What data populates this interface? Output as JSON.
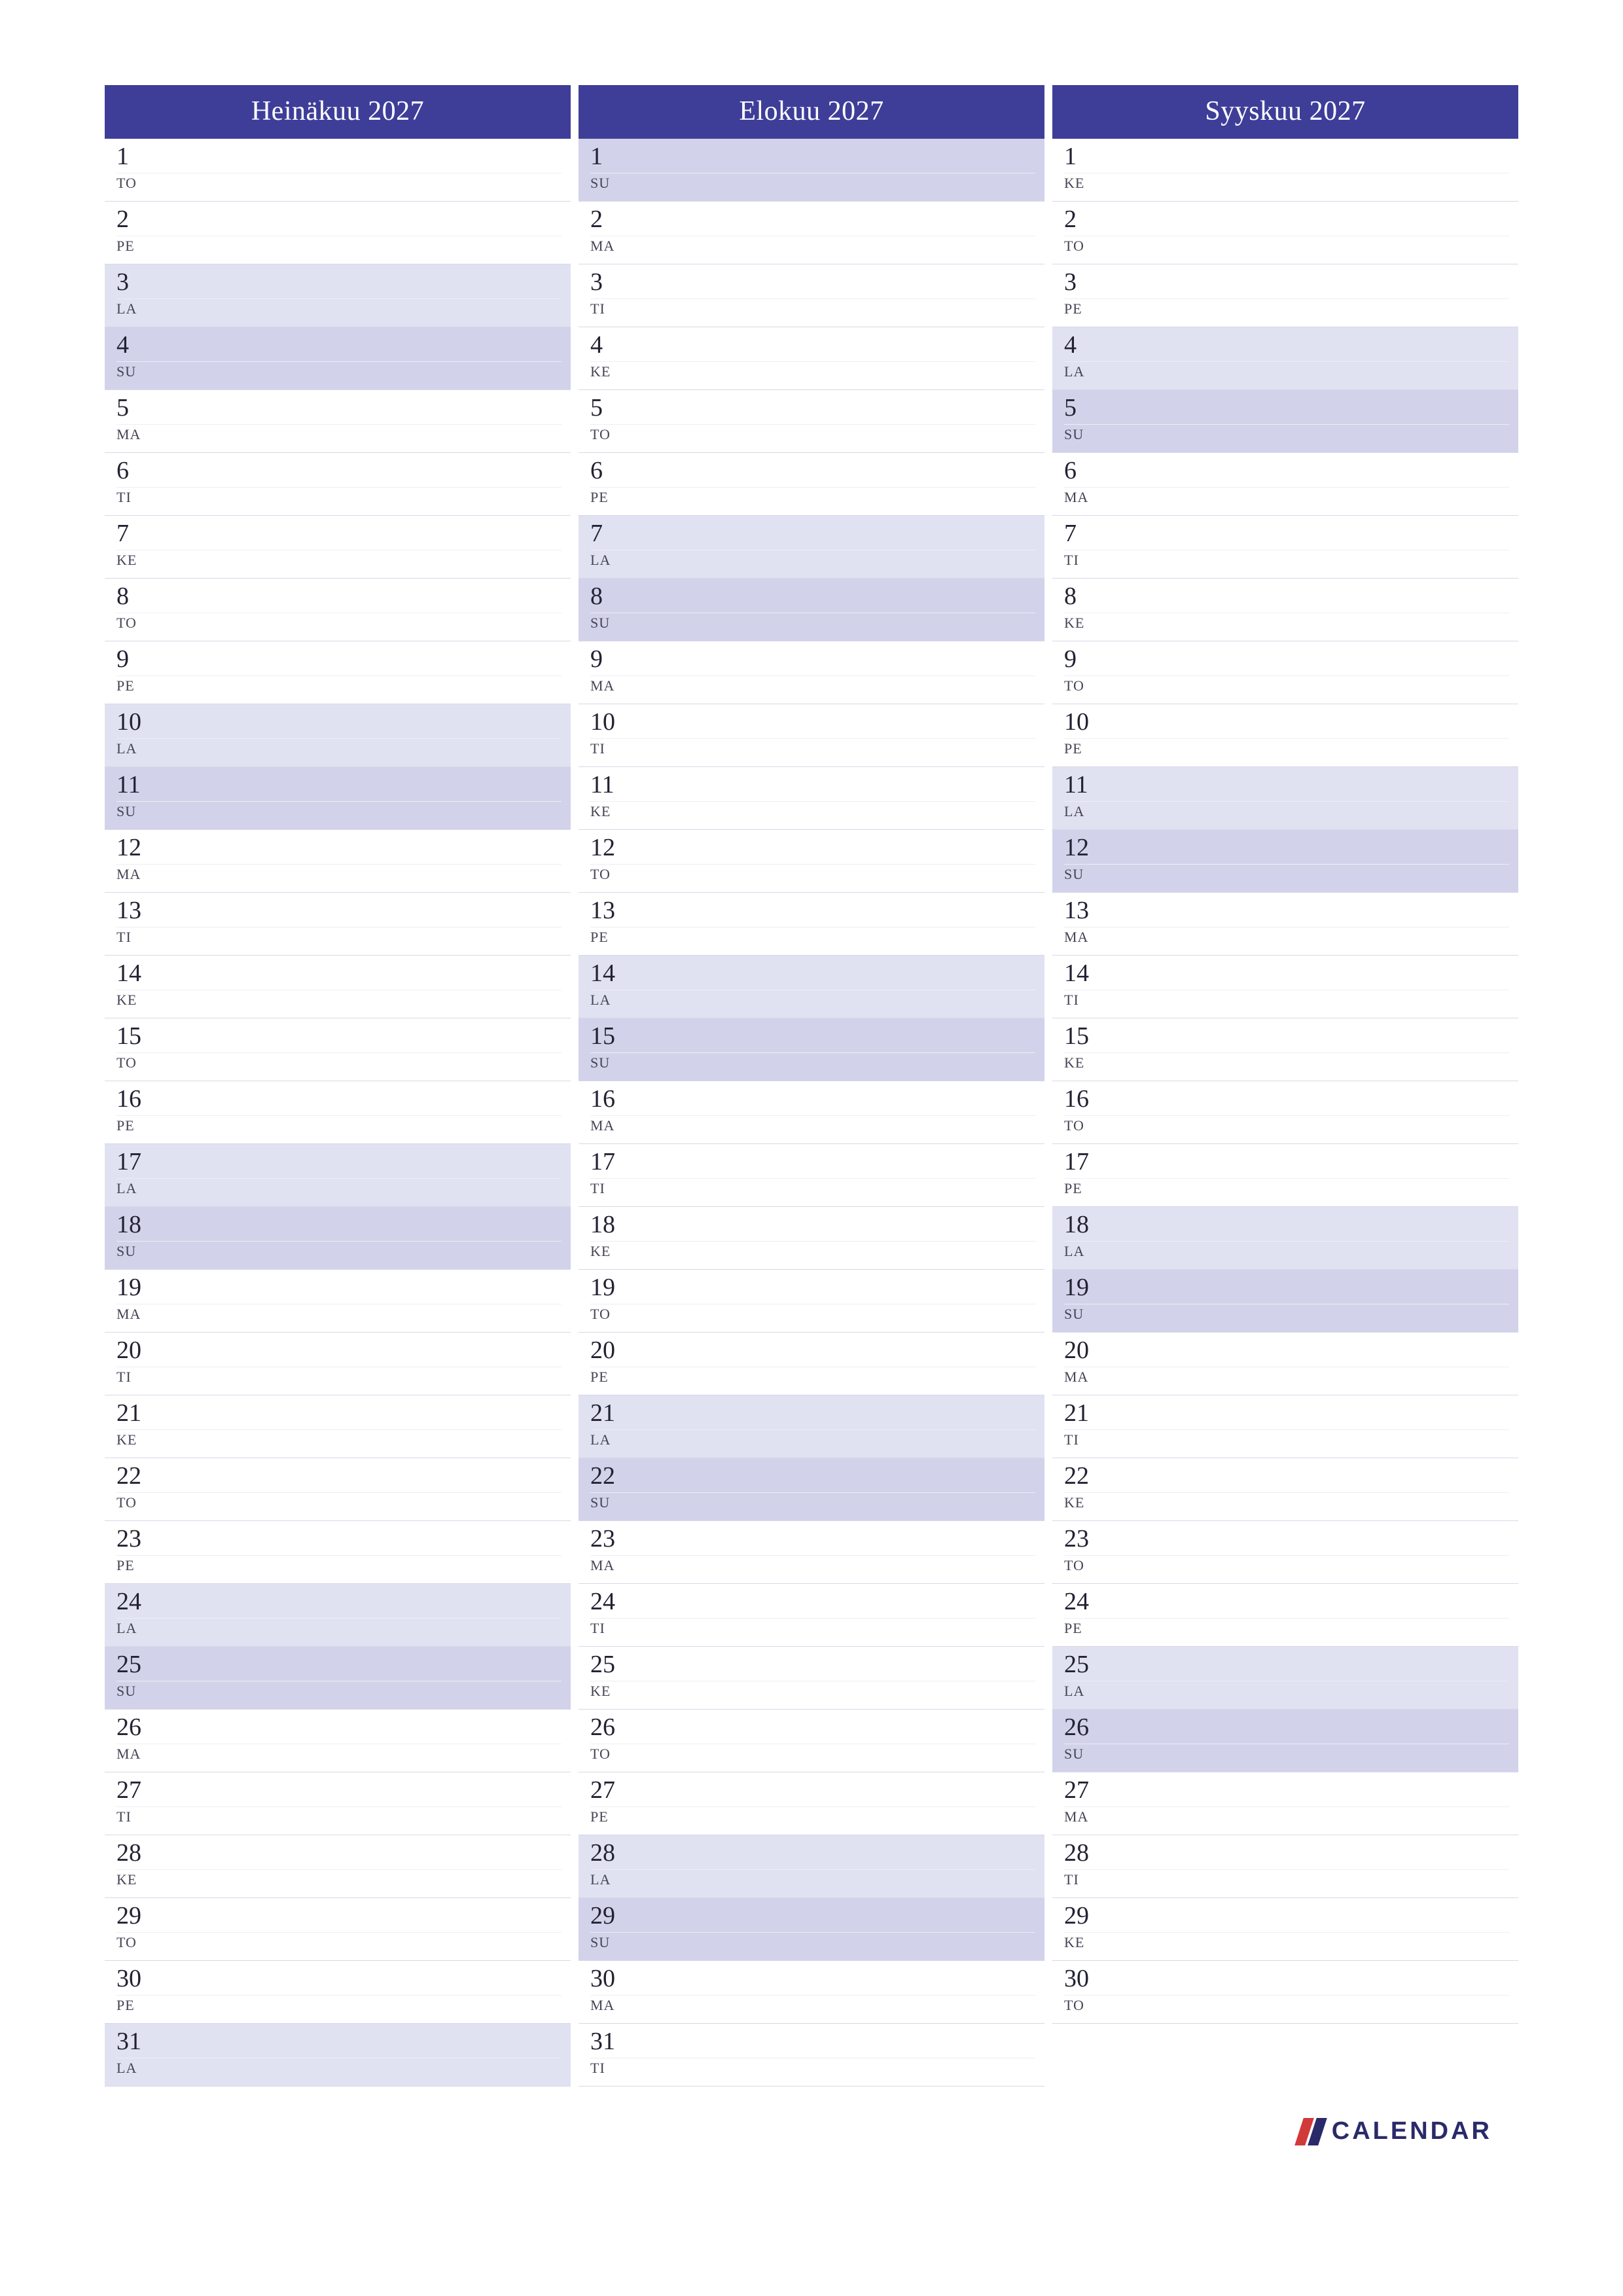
{
  "months": [
    {
      "title": "Heinäkuu 2027",
      "days": [
        {
          "n": "1",
          "a": "TO",
          "t": "weekday"
        },
        {
          "n": "2",
          "a": "PE",
          "t": "weekday"
        },
        {
          "n": "3",
          "a": "LA",
          "t": "sat"
        },
        {
          "n": "4",
          "a": "SU",
          "t": "sun"
        },
        {
          "n": "5",
          "a": "MA",
          "t": "weekday"
        },
        {
          "n": "6",
          "a": "TI",
          "t": "weekday"
        },
        {
          "n": "7",
          "a": "KE",
          "t": "weekday"
        },
        {
          "n": "8",
          "a": "TO",
          "t": "weekday"
        },
        {
          "n": "9",
          "a": "PE",
          "t": "weekday"
        },
        {
          "n": "10",
          "a": "LA",
          "t": "sat"
        },
        {
          "n": "11",
          "a": "SU",
          "t": "sun"
        },
        {
          "n": "12",
          "a": "MA",
          "t": "weekday"
        },
        {
          "n": "13",
          "a": "TI",
          "t": "weekday"
        },
        {
          "n": "14",
          "a": "KE",
          "t": "weekday"
        },
        {
          "n": "15",
          "a": "TO",
          "t": "weekday"
        },
        {
          "n": "16",
          "a": "PE",
          "t": "weekday"
        },
        {
          "n": "17",
          "a": "LA",
          "t": "sat"
        },
        {
          "n": "18",
          "a": "SU",
          "t": "sun"
        },
        {
          "n": "19",
          "a": "MA",
          "t": "weekday"
        },
        {
          "n": "20",
          "a": "TI",
          "t": "weekday"
        },
        {
          "n": "21",
          "a": "KE",
          "t": "weekday"
        },
        {
          "n": "22",
          "a": "TO",
          "t": "weekday"
        },
        {
          "n": "23",
          "a": "PE",
          "t": "weekday"
        },
        {
          "n": "24",
          "a": "LA",
          "t": "sat"
        },
        {
          "n": "25",
          "a": "SU",
          "t": "sun"
        },
        {
          "n": "26",
          "a": "MA",
          "t": "weekday"
        },
        {
          "n": "27",
          "a": "TI",
          "t": "weekday"
        },
        {
          "n": "28",
          "a": "KE",
          "t": "weekday"
        },
        {
          "n": "29",
          "a": "TO",
          "t": "weekday"
        },
        {
          "n": "30",
          "a": "PE",
          "t": "weekday"
        },
        {
          "n": "31",
          "a": "LA",
          "t": "sat"
        }
      ]
    },
    {
      "title": "Elokuu 2027",
      "days": [
        {
          "n": "1",
          "a": "SU",
          "t": "sun"
        },
        {
          "n": "2",
          "a": "MA",
          "t": "weekday"
        },
        {
          "n": "3",
          "a": "TI",
          "t": "weekday"
        },
        {
          "n": "4",
          "a": "KE",
          "t": "weekday"
        },
        {
          "n": "5",
          "a": "TO",
          "t": "weekday"
        },
        {
          "n": "6",
          "a": "PE",
          "t": "weekday"
        },
        {
          "n": "7",
          "a": "LA",
          "t": "sat"
        },
        {
          "n": "8",
          "a": "SU",
          "t": "sun"
        },
        {
          "n": "9",
          "a": "MA",
          "t": "weekday"
        },
        {
          "n": "10",
          "a": "TI",
          "t": "weekday"
        },
        {
          "n": "11",
          "a": "KE",
          "t": "weekday"
        },
        {
          "n": "12",
          "a": "TO",
          "t": "weekday"
        },
        {
          "n": "13",
          "a": "PE",
          "t": "weekday"
        },
        {
          "n": "14",
          "a": "LA",
          "t": "sat"
        },
        {
          "n": "15",
          "a": "SU",
          "t": "sun"
        },
        {
          "n": "16",
          "a": "MA",
          "t": "weekday"
        },
        {
          "n": "17",
          "a": "TI",
          "t": "weekday"
        },
        {
          "n": "18",
          "a": "KE",
          "t": "weekday"
        },
        {
          "n": "19",
          "a": "TO",
          "t": "weekday"
        },
        {
          "n": "20",
          "a": "PE",
          "t": "weekday"
        },
        {
          "n": "21",
          "a": "LA",
          "t": "sat"
        },
        {
          "n": "22",
          "a": "SU",
          "t": "sun"
        },
        {
          "n": "23",
          "a": "MA",
          "t": "weekday"
        },
        {
          "n": "24",
          "a": "TI",
          "t": "weekday"
        },
        {
          "n": "25",
          "a": "KE",
          "t": "weekday"
        },
        {
          "n": "26",
          "a": "TO",
          "t": "weekday"
        },
        {
          "n": "27",
          "a": "PE",
          "t": "weekday"
        },
        {
          "n": "28",
          "a": "LA",
          "t": "sat"
        },
        {
          "n": "29",
          "a": "SU",
          "t": "sun"
        },
        {
          "n": "30",
          "a": "MA",
          "t": "weekday"
        },
        {
          "n": "31",
          "a": "TI",
          "t": "weekday"
        }
      ]
    },
    {
      "title": "Syyskuu 2027",
      "days": [
        {
          "n": "1",
          "a": "KE",
          "t": "weekday"
        },
        {
          "n": "2",
          "a": "TO",
          "t": "weekday"
        },
        {
          "n": "3",
          "a": "PE",
          "t": "weekday"
        },
        {
          "n": "4",
          "a": "LA",
          "t": "sat"
        },
        {
          "n": "5",
          "a": "SU",
          "t": "sun"
        },
        {
          "n": "6",
          "a": "MA",
          "t": "weekday"
        },
        {
          "n": "7",
          "a": "TI",
          "t": "weekday"
        },
        {
          "n": "8",
          "a": "KE",
          "t": "weekday"
        },
        {
          "n": "9",
          "a": "TO",
          "t": "weekday"
        },
        {
          "n": "10",
          "a": "PE",
          "t": "weekday"
        },
        {
          "n": "11",
          "a": "LA",
          "t": "sat"
        },
        {
          "n": "12",
          "a": "SU",
          "t": "sun"
        },
        {
          "n": "13",
          "a": "MA",
          "t": "weekday"
        },
        {
          "n": "14",
          "a": "TI",
          "t": "weekday"
        },
        {
          "n": "15",
          "a": "KE",
          "t": "weekday"
        },
        {
          "n": "16",
          "a": "TO",
          "t": "weekday"
        },
        {
          "n": "17",
          "a": "PE",
          "t": "weekday"
        },
        {
          "n": "18",
          "a": "LA",
          "t": "sat"
        },
        {
          "n": "19",
          "a": "SU",
          "t": "sun"
        },
        {
          "n": "20",
          "a": "MA",
          "t": "weekday"
        },
        {
          "n": "21",
          "a": "TI",
          "t": "weekday"
        },
        {
          "n": "22",
          "a": "KE",
          "t": "weekday"
        },
        {
          "n": "23",
          "a": "TO",
          "t": "weekday"
        },
        {
          "n": "24",
          "a": "PE",
          "t": "weekday"
        },
        {
          "n": "25",
          "a": "LA",
          "t": "sat"
        },
        {
          "n": "26",
          "a": "SU",
          "t": "sun"
        },
        {
          "n": "27",
          "a": "MA",
          "t": "weekday"
        },
        {
          "n": "28",
          "a": "TI",
          "t": "weekday"
        },
        {
          "n": "29",
          "a": "KE",
          "t": "weekday"
        },
        {
          "n": "30",
          "a": "TO",
          "t": "weekday"
        }
      ]
    }
  ],
  "footer": {
    "brand": "CALENDAR"
  }
}
